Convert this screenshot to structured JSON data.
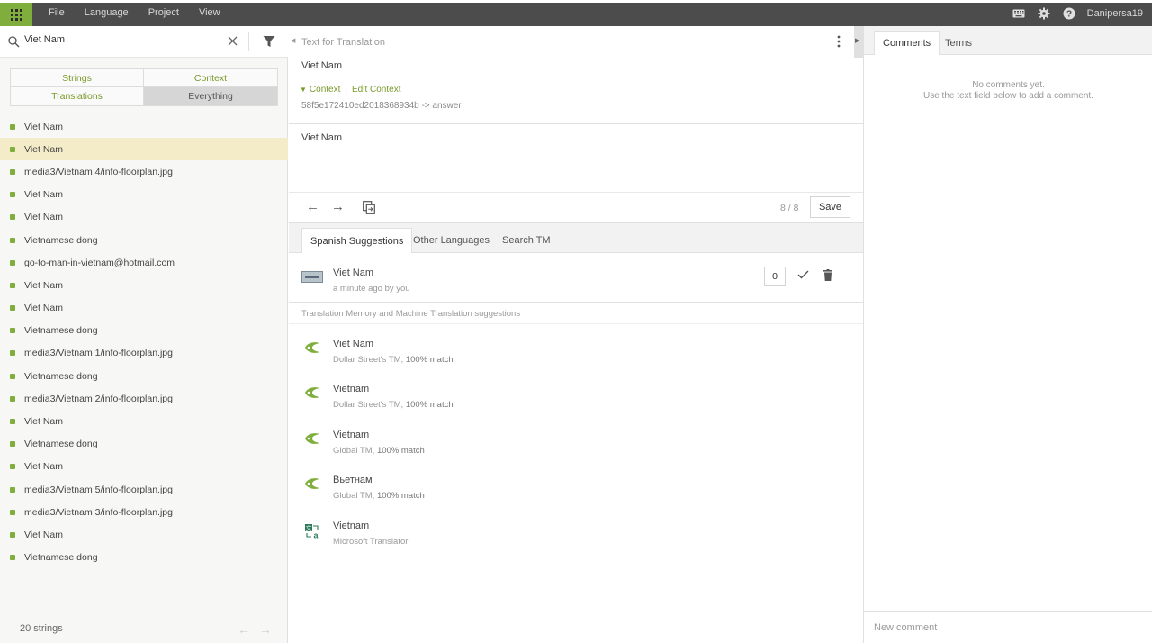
{
  "menu": [
    "File",
    "Language",
    "Project",
    "View"
  ],
  "user": {
    "name": "Danipersa19"
  },
  "search": {
    "value": "Viet Nam"
  },
  "filters": [
    "Strings",
    "Context",
    "Translations",
    "Everything"
  ],
  "strings": [
    "Viet Nam",
    "Viet Nam",
    "media3/Vietnam 4/info-floorplan.jpg",
    "Viet Nam",
    "Viet Nam",
    "Vietnamese dong",
    "go-to-man-in-vietnam@hotmail.com",
    "Viet Nam",
    "Viet Nam",
    "Vietnamese dong",
    "media3/Vietnam 1/info-floorplan.jpg",
    "Vietnamese dong",
    "media3/Vietnam 2/info-floorplan.jpg",
    "Viet Nam",
    "Vietnamese dong",
    "Viet Nam",
    "media3/Vietnam 5/info-floorplan.jpg",
    "media3/Vietnam 3/info-floorplan.jpg",
    "Viet Nam",
    "Vietnamese dong"
  ],
  "selected_string_index": 1,
  "left_footer": {
    "count": "20 strings"
  },
  "source": {
    "label": "Text for Translation",
    "text": "Viet Nam",
    "context_label": "Context",
    "edit_context": "Edit Context",
    "context_key": "58f5e172410ed2018368934b -> answer"
  },
  "translation": {
    "value": "Viet Nam"
  },
  "toolbar": {
    "counter": "8 / 8",
    "save_label": "Save"
  },
  "suggestion_tabs": [
    "Spanish Suggestions",
    "Other Languages",
    "Search TM"
  ],
  "own_suggestion": {
    "text": "Viet Nam",
    "meta": "a minute ago by you",
    "votes": "0"
  },
  "tm_header": "Translation Memory and Machine Translation suggestions",
  "tm_suggestions": [
    {
      "text": "Viet Nam",
      "source": "Dollar Street's TM,",
      "match": "100% match",
      "icon": "tm-icon"
    },
    {
      "text": "Vietnam",
      "source": "Dollar Street's TM,",
      "match": "100% match",
      "icon": "tm-icon"
    },
    {
      "text": "Vietnam",
      "source": "Global TM,",
      "match": "100% match",
      "icon": "tm-icon"
    },
    {
      "text": "Вьетнам",
      "source": "Global TM,",
      "match": "100% match",
      "icon": "tm-icon"
    },
    {
      "text": "Vietnam",
      "source": "Microsoft Translator",
      "match": "",
      "icon": "microsoft-translator-icon"
    }
  ],
  "right_tabs": [
    "Comments",
    "Terms"
  ],
  "comments": {
    "empty_line1": "No comments yet.",
    "empty_line2": "Use the text field below to add a comment.",
    "placeholder": "New comment"
  },
  "colors": {
    "accent": "#7fae3c",
    "topbar": "#4c4c4c",
    "selected_row": "#f4ecc9"
  }
}
